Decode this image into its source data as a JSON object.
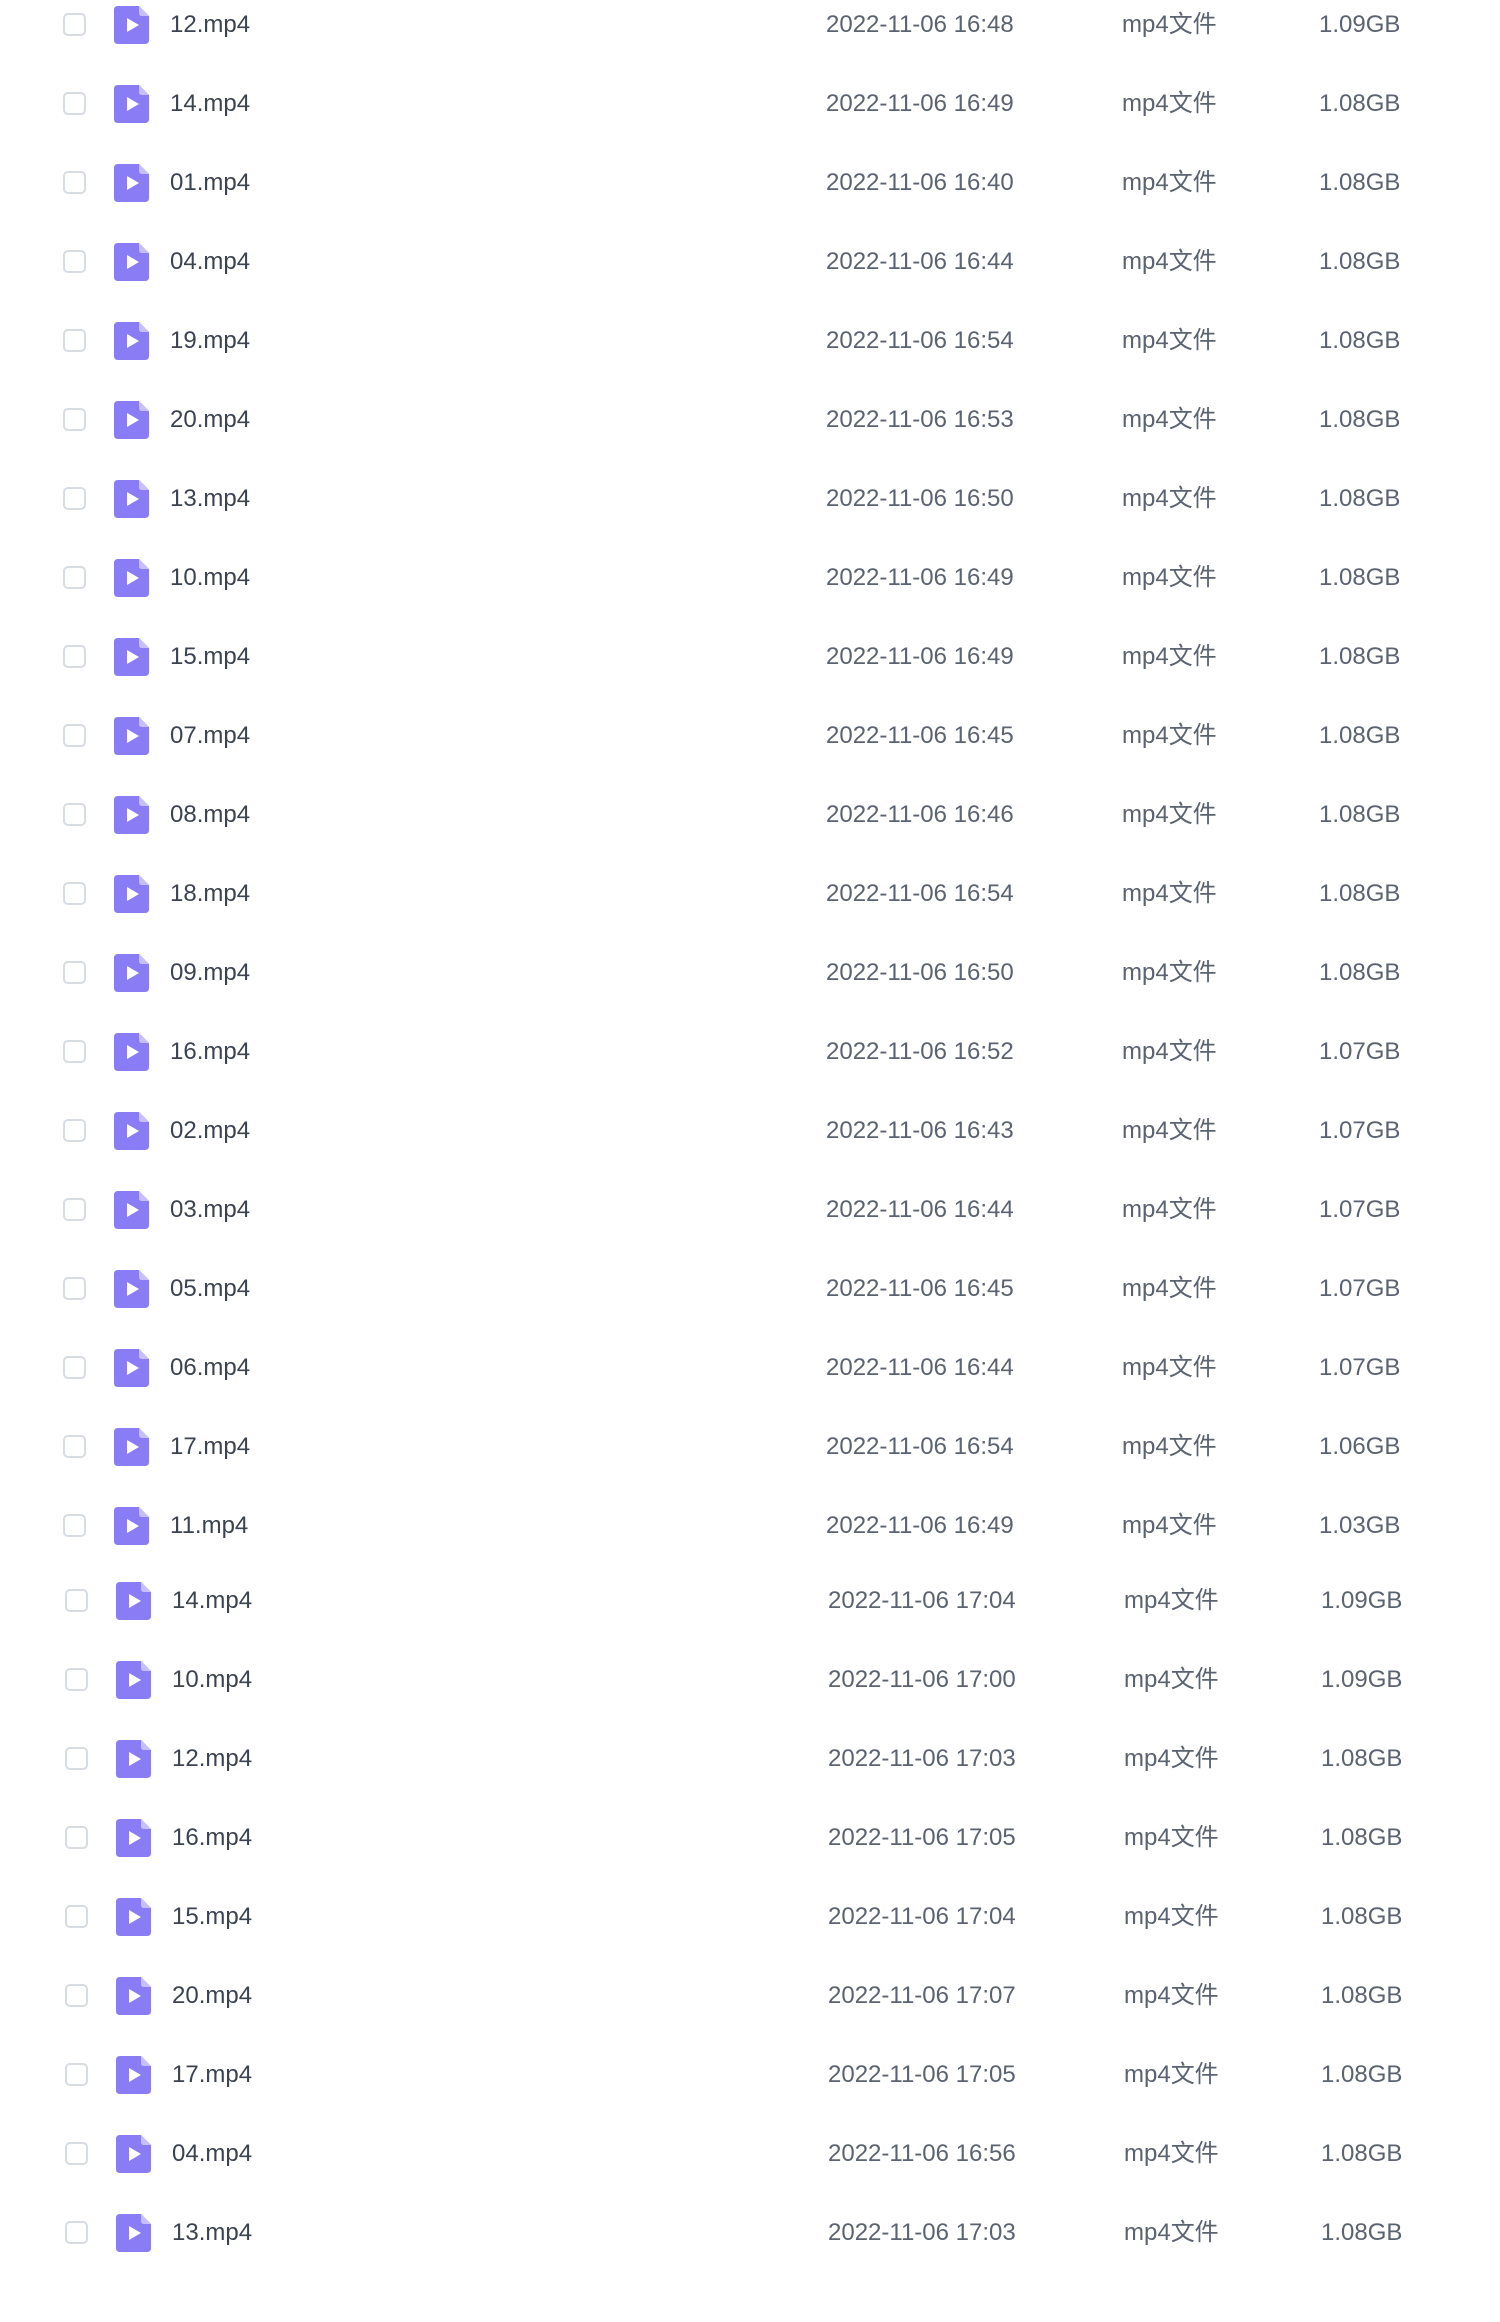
{
  "colors": {
    "icon_bg": "#8a7cf4",
    "icon_fold": "#c7bffb",
    "checkbox_border": "#d7dbe2",
    "text_primary": "#3b4250",
    "text_secondary": "#5b6270"
  },
  "row_icon": "video-file-icon",
  "files": [
    {
      "name": "12.mp4",
      "date": "2022-11-06 16:48",
      "type": "mp4文件",
      "size": "1.09GB"
    },
    {
      "name": "14.mp4",
      "date": "2022-11-06 16:49",
      "type": "mp4文件",
      "size": "1.08GB"
    },
    {
      "name": "01.mp4",
      "date": "2022-11-06 16:40",
      "type": "mp4文件",
      "size": "1.08GB"
    },
    {
      "name": "04.mp4",
      "date": "2022-11-06 16:44",
      "type": "mp4文件",
      "size": "1.08GB"
    },
    {
      "name": "19.mp4",
      "date": "2022-11-06 16:54",
      "type": "mp4文件",
      "size": "1.08GB"
    },
    {
      "name": "20.mp4",
      "date": "2022-11-06 16:53",
      "type": "mp4文件",
      "size": "1.08GB"
    },
    {
      "name": "13.mp4",
      "date": "2022-11-06 16:50",
      "type": "mp4文件",
      "size": "1.08GB"
    },
    {
      "name": "10.mp4",
      "date": "2022-11-06 16:49",
      "type": "mp4文件",
      "size": "1.08GB"
    },
    {
      "name": "15.mp4",
      "date": "2022-11-06 16:49",
      "type": "mp4文件",
      "size": "1.08GB"
    },
    {
      "name": "07.mp4",
      "date": "2022-11-06 16:45",
      "type": "mp4文件",
      "size": "1.08GB"
    },
    {
      "name": "08.mp4",
      "date": "2022-11-06 16:46",
      "type": "mp4文件",
      "size": "1.08GB"
    },
    {
      "name": "18.mp4",
      "date": "2022-11-06 16:54",
      "type": "mp4文件",
      "size": "1.08GB"
    },
    {
      "name": "09.mp4",
      "date": "2022-11-06 16:50",
      "type": "mp4文件",
      "size": "1.08GB"
    },
    {
      "name": "16.mp4",
      "date": "2022-11-06 16:52",
      "type": "mp4文件",
      "size": "1.07GB"
    },
    {
      "name": "02.mp4",
      "date": "2022-11-06 16:43",
      "type": "mp4文件",
      "size": "1.07GB"
    },
    {
      "name": "03.mp4",
      "date": "2022-11-06 16:44",
      "type": "mp4文件",
      "size": "1.07GB"
    },
    {
      "name": "05.mp4",
      "date": "2022-11-06 16:45",
      "type": "mp4文件",
      "size": "1.07GB"
    },
    {
      "name": "06.mp4",
      "date": "2022-11-06 16:44",
      "type": "mp4文件",
      "size": "1.07GB"
    },
    {
      "name": "17.mp4",
      "date": "2022-11-06 16:54",
      "type": "mp4文件",
      "size": "1.06GB"
    },
    {
      "name": "11.mp4",
      "date": "2022-11-06 16:49",
      "type": "mp4文件",
      "size": "1.03GB"
    },
    {
      "name": "14.mp4",
      "date": "2022-11-06 17:04",
      "type": "mp4文件",
      "size": "1.09GB"
    },
    {
      "name": "10.mp4",
      "date": "2022-11-06 17:00",
      "type": "mp4文件",
      "size": "1.09GB"
    },
    {
      "name": "12.mp4",
      "date": "2022-11-06 17:03",
      "type": "mp4文件",
      "size": "1.08GB"
    },
    {
      "name": "16.mp4",
      "date": "2022-11-06 17:05",
      "type": "mp4文件",
      "size": "1.08GB"
    },
    {
      "name": "15.mp4",
      "date": "2022-11-06 17:04",
      "type": "mp4文件",
      "size": "1.08GB"
    },
    {
      "name": "20.mp4",
      "date": "2022-11-06 17:07",
      "type": "mp4文件",
      "size": "1.08GB"
    },
    {
      "name": "17.mp4",
      "date": "2022-11-06 17:05",
      "type": "mp4文件",
      "size": "1.08GB"
    },
    {
      "name": "04.mp4",
      "date": "2022-11-06 16:56",
      "type": "mp4文件",
      "size": "1.08GB"
    },
    {
      "name": "13.mp4",
      "date": "2022-11-06 17:03",
      "type": "mp4文件",
      "size": "1.08GB"
    }
  ]
}
